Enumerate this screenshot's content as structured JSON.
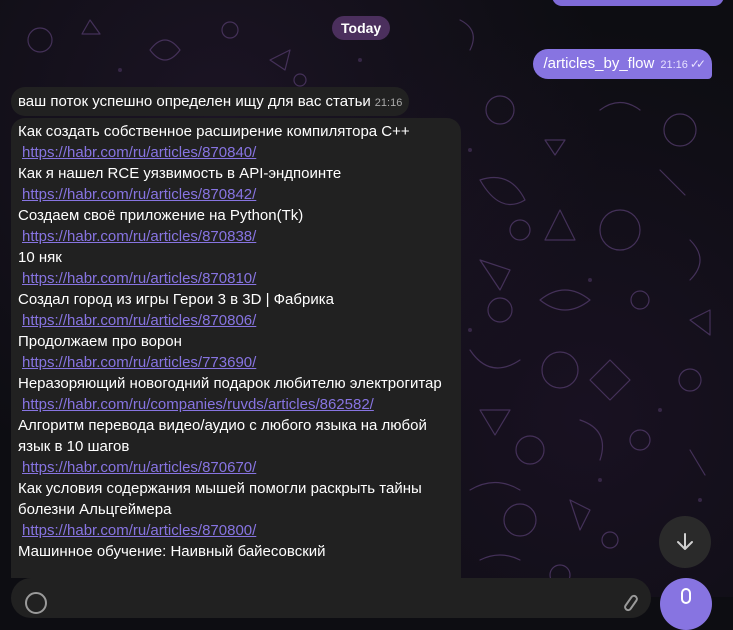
{
  "date_separator": "Today",
  "outgoing": {
    "text": "/articles_by_flow",
    "time": "21:16",
    "status_icon": "double-check-icon"
  },
  "incoming_status": {
    "text": "ваш поток успешно определен ищу для вас статьи",
    "time": "21:16"
  },
  "articles": [
    {
      "title": "Как создать собственное расширение компилятора C++",
      "url": "https://habr.com/ru/articles/870840/"
    },
    {
      "title": "Как я нашел RCE уязвимость в API-эндпоинте",
      "url": "https://habr.com/ru/articles/870842/"
    },
    {
      "title": "Создаем своё приложение на Python(Tk)",
      "url": "https://habr.com/ru/articles/870838/"
    },
    {
      "title": "10 няк",
      "url": "https://habr.com/ru/articles/870810/"
    },
    {
      "title": "Создал город из игры Герои 3 в 3D | Фабрика",
      "url": "https://habr.com/ru/articles/870806/"
    },
    {
      "title": "Продолжаем про ворон",
      "url": "https://habr.com/ru/articles/773690/"
    },
    {
      "title": "Неразоряющий новогодний подарок любителю электрогитар",
      "url": "https://habr.com/ru/companies/ruvds/articles/862582/"
    },
    {
      "title": "Алгоритм перевода видео/аудио с любого языка на любой язык в 10 шагов",
      "url": "https://habr.com/ru/articles/870670/"
    },
    {
      "title": "Как условия содержания мышей помогли раскрыть тайны болезни Альцгеймера",
      "url": "https://habr.com/ru/articles/870800/"
    },
    {
      "title": "Машинное обучение: Наивный байесовский",
      "url": ""
    }
  ],
  "colors": {
    "accent": "#8774e1",
    "bubble_incoming": "#212121",
    "date_pill": "#4b2f5d",
    "background": "#0d0d12"
  },
  "icons": {
    "scroll_down": "arrow-down-icon",
    "emoji": "emoji-icon",
    "attach": "paperclip-icon",
    "send": "microphone-icon"
  }
}
